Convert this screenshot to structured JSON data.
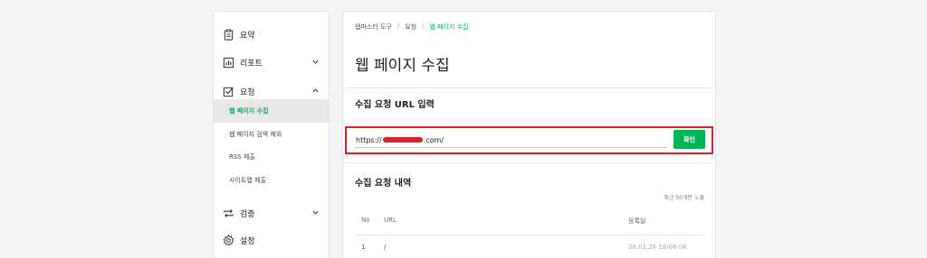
{
  "sidebar": {
    "items": [
      {
        "label": "요약",
        "icon": "clipboard-icon"
      },
      {
        "label": "리포트",
        "icon": "bar-chart-icon",
        "expanded": false
      },
      {
        "label": "요청",
        "icon": "checkbox-icon",
        "expanded": true
      },
      {
        "label": "검증",
        "icon": "repeat-icon",
        "expanded": false
      },
      {
        "label": "설정",
        "icon": "gear-icon"
      }
    ],
    "sub_items": [
      {
        "label": "웹 페이지 수집",
        "active": true
      },
      {
        "label": "웹 페이지 검색 제외"
      },
      {
        "label": "RSS 제출"
      },
      {
        "label": "사이트맵 제출"
      }
    ]
  },
  "breadcrumb": [
    "웹마스터 도구",
    "요청",
    "웹 페이지 수집"
  ],
  "page_title": "웹 페이지 수집",
  "request_section": {
    "title": "수집 요청 URL 입력",
    "input_prefix": "https://",
    "input_suffix": ".com/",
    "button_label": "확인"
  },
  "history_section": {
    "title": "수집 요청 내역",
    "note": "최근 50개만 노출",
    "columns": [
      "No",
      "URL",
      "등록일"
    ],
    "rows": [
      {
        "no": "1",
        "url": "/",
        "date": "26.01.26 18:06:06"
      }
    ]
  },
  "colors": {
    "accent": "#03b358",
    "highlight": "#e01f26"
  }
}
